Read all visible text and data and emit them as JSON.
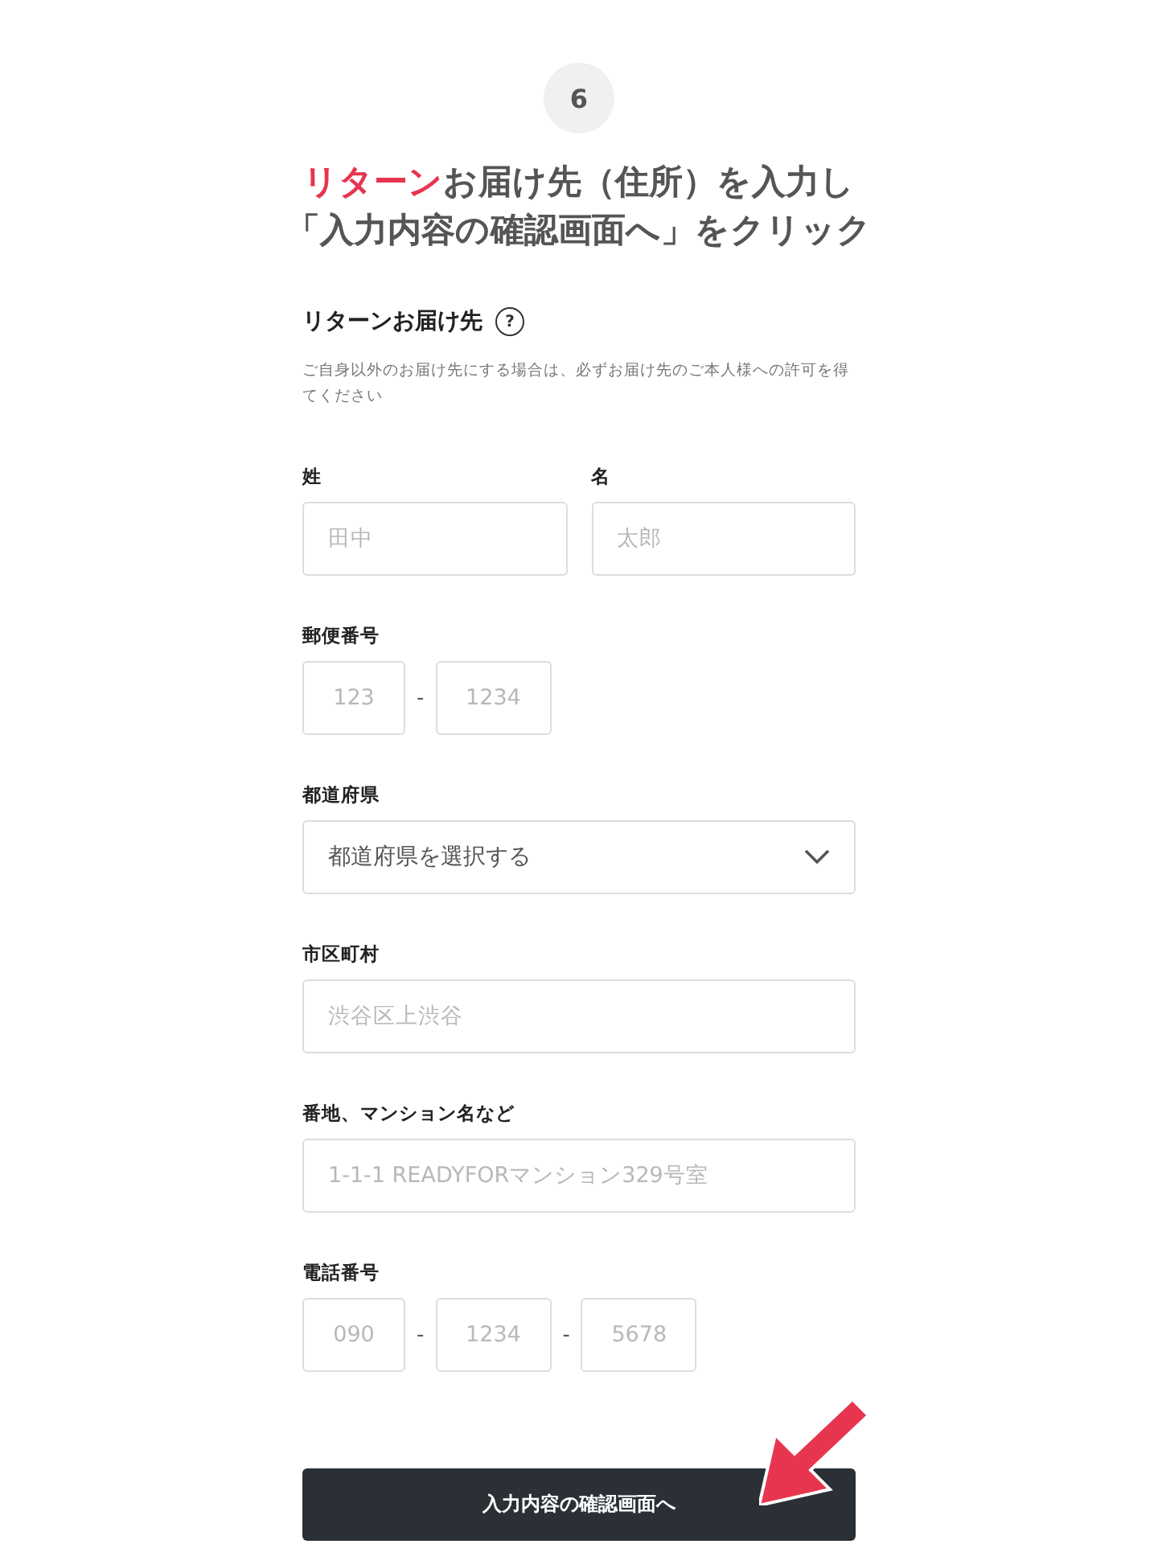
{
  "step": "6",
  "title_lines": [
    [
      {
        "text": "リターン",
        "accent": true
      },
      {
        "text": "お届け先（住所）を入力し",
        "accent": false
      }
    ],
    [
      {
        "text": "「入力内容の確認画面へ」をクリック",
        "accent": false
      }
    ]
  ],
  "form": {
    "heading": "リターンお届け先",
    "help_icon": "?",
    "note": "ご自身以外のお届け先にする場合は、必ずお届け先のご本人様への許可を得てください",
    "name_fields": [
      {
        "label": "姓",
        "placeholder": "田中"
      },
      {
        "label": "名",
        "placeholder": "太郎"
      }
    ],
    "fields": [
      {
        "label": "郵便番号",
        "kind": "parts",
        "parts": [
          {
            "kind": "input",
            "placeholder": "123"
          },
          {
            "kind": "separator",
            "text": "-"
          },
          {
            "kind": "input",
            "placeholder": "1234"
          }
        ]
      },
      {
        "label": "都道府県",
        "kind": "select",
        "value": "都道府県を選択する"
      },
      {
        "label": "市区町村",
        "kind": "text",
        "placeholder": "渋谷区上渋谷"
      },
      {
        "label": "番地、マンション名など",
        "kind": "text",
        "placeholder": "1-1-1 READYFORマンション329号室"
      },
      {
        "label": "電話番号",
        "kind": "parts",
        "parts": [
          {
            "kind": "input",
            "placeholder": "090"
          },
          {
            "kind": "separator",
            "text": "-"
          },
          {
            "kind": "input",
            "placeholder": "1234"
          },
          {
            "kind": "separator",
            "text": "-"
          },
          {
            "kind": "input",
            "placeholder": "5678"
          }
        ]
      }
    ],
    "submit": "入力内容の確認画面へ"
  }
}
